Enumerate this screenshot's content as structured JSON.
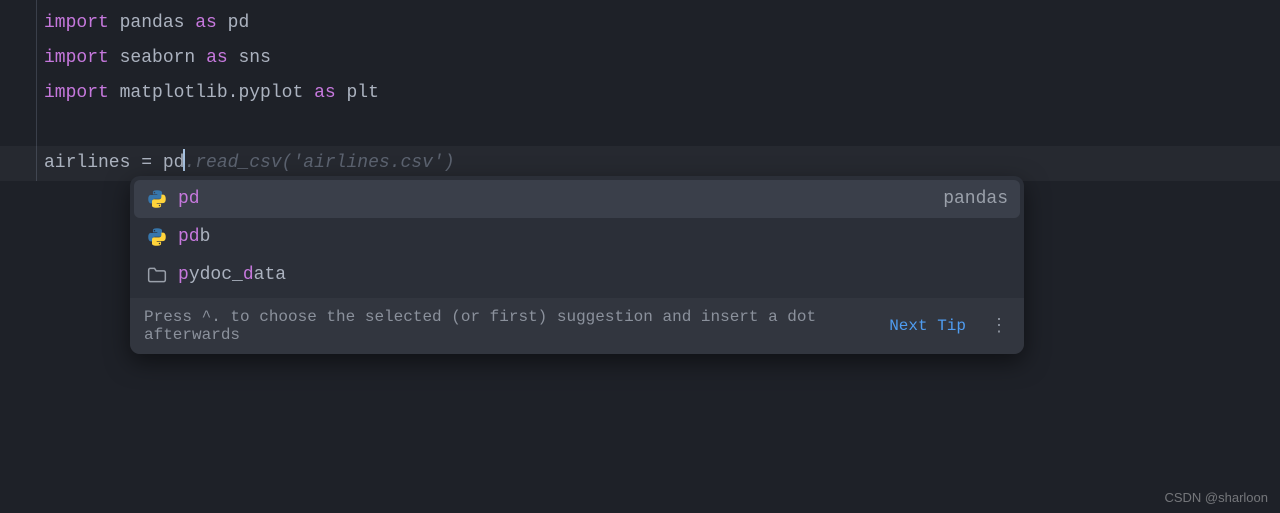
{
  "code": {
    "line1": {
      "kw": "import",
      "mod": "pandas",
      "as": "as",
      "alias": "pd"
    },
    "line2": {
      "kw": "import",
      "mod": "seaborn",
      "as": "as",
      "alias": "sns"
    },
    "line3": {
      "kw": "import",
      "mod": "matplotlib.pyplot",
      "as": "as",
      "alias": "plt"
    },
    "line5": {
      "var": "airlines",
      "eq": " = ",
      "typed": "pd",
      "ghost_dot": ".",
      "ghost_func": "read_csv",
      "ghost_paren_open": "(",
      "ghost_str": "'airlines.csv'",
      "ghost_paren_close": ")"
    }
  },
  "autocomplete": {
    "items": [
      {
        "match": "pd",
        "rest": "",
        "right": "pandas",
        "icon": "python"
      },
      {
        "match": "pd",
        "rest": "b",
        "right": "",
        "icon": "python"
      },
      {
        "match_before": "p",
        "mid": "ydoc_",
        "match_mid": "d",
        "rest": "ata",
        "right": "",
        "icon": "folder"
      }
    ],
    "footer": {
      "hint": "Press ^. to choose the selected (or first) suggestion and insert a dot afterwards",
      "next_tip": "Next Tip",
      "more": "⋮"
    }
  },
  "watermark": "CSDN @sharloon"
}
